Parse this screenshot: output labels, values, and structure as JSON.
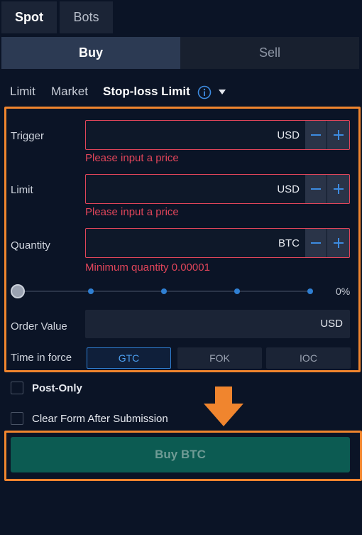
{
  "tabs": {
    "spot": "Spot",
    "bots": "Bots"
  },
  "sides": {
    "buy": "Buy",
    "sell": "Sell"
  },
  "order_types": {
    "limit": "Limit",
    "market": "Market",
    "stop_loss_limit": "Stop-loss Limit"
  },
  "form": {
    "trigger": {
      "label": "Trigger",
      "unit": "USD",
      "error": "Please input a price"
    },
    "limit": {
      "label": "Limit",
      "unit": "USD",
      "error": "Please input a price"
    },
    "quantity": {
      "label": "Quantity",
      "unit": "BTC",
      "error": "Minimum quantity 0.00001"
    },
    "slider": {
      "percent_label": "0%",
      "value": 0
    },
    "order_value": {
      "label": "Order Value",
      "unit": "USD"
    },
    "time_in_force": {
      "label": "Time in force",
      "options": [
        "GTC",
        "FOK",
        "IOC"
      ],
      "selected": "GTC"
    }
  },
  "options": {
    "post_only": "Post-Only",
    "clear_form": "Clear Form After Submission"
  },
  "submit": {
    "label": "Buy BTC"
  },
  "colors": {
    "highlight": "#f0852e",
    "error": "#e0455a",
    "accent": "#2f7fd2",
    "buy_button": "#0c5b52"
  }
}
